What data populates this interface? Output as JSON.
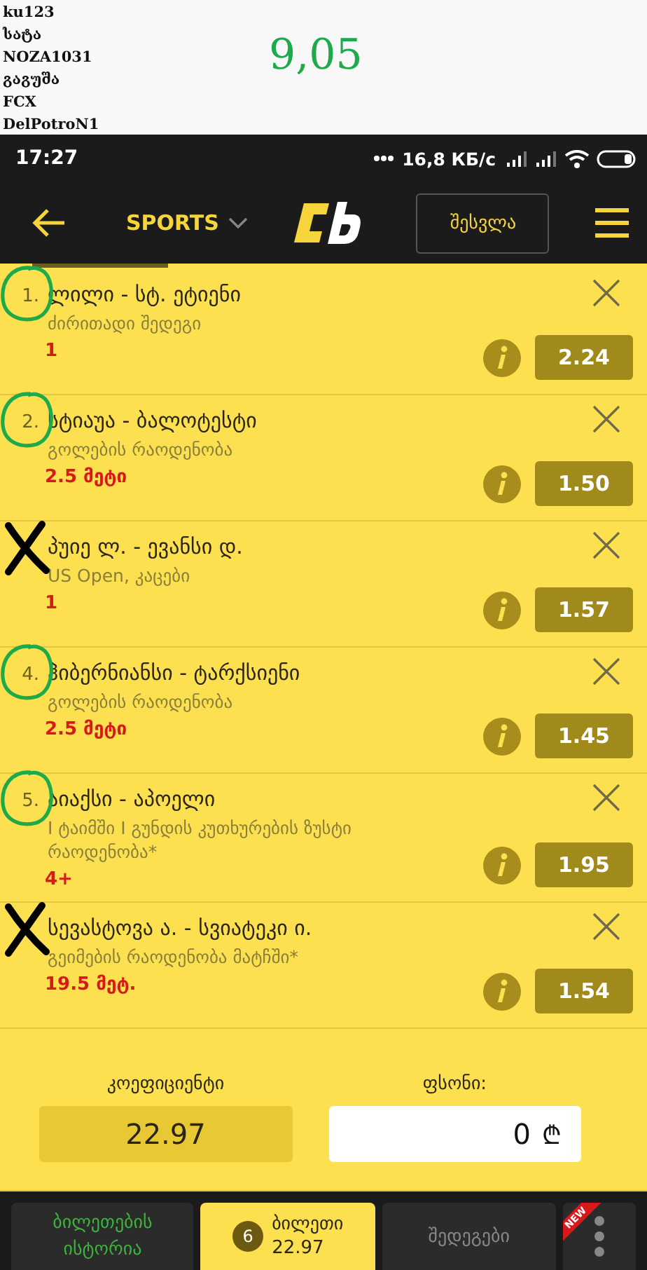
{
  "header_notes": {
    "names": [
      "ku123",
      "სატა",
      "NOZA1031",
      "გაგუშა",
      "FCX",
      "DelPotroN1"
    ],
    "score": "9,05"
  },
  "status_bar": {
    "time": "17:27",
    "speed": "16,8 КБ/с"
  },
  "app_bar": {
    "menu_label": "SPORTS",
    "login": "შესვლა"
  },
  "bets": [
    {
      "kind": "circled",
      "number": "1.",
      "match": "ლილი - სტ. ეტიენი",
      "market": "ძირითადი შედეგი",
      "pick": "1",
      "odds": "2.24"
    },
    {
      "kind": "circled",
      "number": "2.",
      "match": "სტიაუა - ბალოტესტი",
      "market": "გოლების რაოდენობა",
      "pick": "2.5 მეტი",
      "odds": "1.50"
    },
    {
      "kind": "crossed",
      "match": "პუიე ლ. - ევანსი დ.",
      "market": "US Open, კაცები",
      "pick": "1",
      "odds": "1.57"
    },
    {
      "kind": "circled",
      "number": "4.",
      "match": "ჰიბერნიანსი - ტარქსიენი",
      "market": "გოლების რაოდენობა",
      "pick": "2.5 მეტი",
      "odds": "1.45"
    },
    {
      "kind": "circled",
      "number": "5.",
      "match": "აიაქსი - აპოელი",
      "market": "I ტაიმში I გუნდის კუთხურების ზუსტი რაოდენობა*",
      "pick": "4+",
      "odds": "1.95"
    },
    {
      "kind": "crossed",
      "match": "სევასტოვა ა. - სვიატეკი ი.",
      "market": "გეიმების რაოდენობა მატჩში*",
      "pick": "19.5 მეტ.",
      "odds": "1.54"
    }
  ],
  "summary": {
    "coef_label": "კოეფიციენტი",
    "coef_value": "22.97",
    "stake_label": "ფსონი:",
    "stake_value": "0",
    "currency": "₾"
  },
  "bottom_tabs": [
    {
      "kind": "history",
      "label": "ბილეთების ისტორია",
      "selected": false
    },
    {
      "kind": "slip",
      "count": "6",
      "label": "ბილეთი",
      "value": "22.97",
      "selected": true
    },
    {
      "kind": "plain",
      "label": "შედეგები",
      "selected": false
    },
    {
      "kind": "more",
      "badge": "NEW",
      "selected": false
    }
  ]
}
